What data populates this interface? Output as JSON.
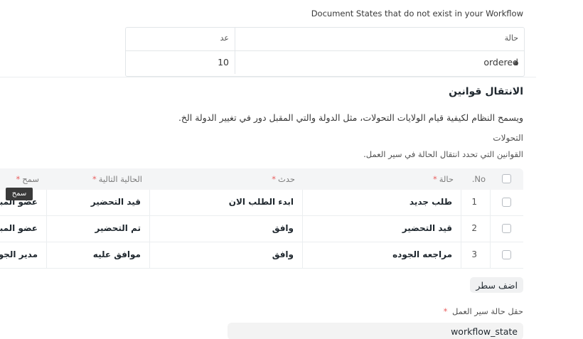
{
  "missing_states": {
    "title": "Document States that do not exist in your Workflow",
    "columns": {
      "state": "حالة",
      "count": "عد"
    },
    "rows": [
      {
        "state": "ordered",
        "count": "10"
      }
    ]
  },
  "transition_rules": {
    "title": "الانتقال قوانين",
    "description": "ويسمح النظام لكيفية قيام الولايات التحولات، مثل الدولة والتي المقبل دور في تغيير الدولة الخ.",
    "table_label": "التحولات",
    "table_description": "القوانين التي تحدد انتقال الحالة في سير العمل.",
    "columns": {
      "no": "No.",
      "state": "حالة",
      "action": "حدث",
      "next_state": "الحالية التالية",
      "allowed": "سمح"
    },
    "required_mark": "*",
    "rows": [
      {
        "no": "1",
        "state": "طلب جديد",
        "action": "ابدء الطلب الان",
        "next_state": "قيد التحضير",
        "allowed": "عضو المبيعات"
      },
      {
        "no": "2",
        "state": "قيد التحضير",
        "action": "وافق",
        "next_state": "تم التحضير",
        "allowed": "عضو المبيعات"
      },
      {
        "no": "3",
        "state": "مراجعه الجوده",
        "action": "وافق",
        "next_state": "موافق عليه",
        "allowed": "مدير الجودة"
      }
    ],
    "tooltip": "سمح",
    "add_row_label": "اضف سطر"
  },
  "workflow_state_field": {
    "label": "حقل حالة سير العمل",
    "required_mark": "*",
    "value": "workflow_state"
  }
}
